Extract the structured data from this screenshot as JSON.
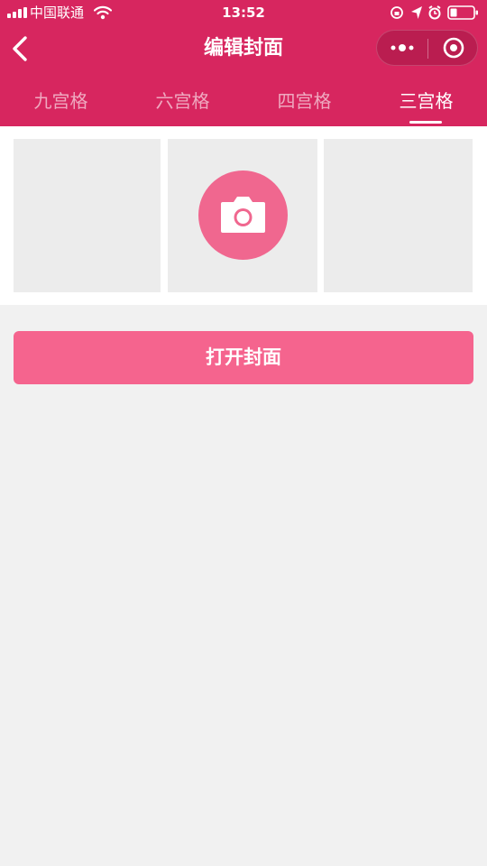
{
  "status_bar": {
    "carrier": "中国联通",
    "time": "13:52"
  },
  "nav": {
    "title": "编辑封面",
    "back_icon": "chevron-left-icon",
    "more_icon": "more-dots-icon",
    "close_icon": "target-circle-icon"
  },
  "tabs": [
    {
      "label": "九宫格",
      "active": false
    },
    {
      "label": "六宫格",
      "active": false
    },
    {
      "label": "四宫格",
      "active": false
    },
    {
      "label": "三宫格",
      "active": true
    }
  ],
  "grid": {
    "upload_icon": "camera-icon"
  },
  "open_button": {
    "label": "打开封面"
  },
  "colors": {
    "header": "#d7265f",
    "accent": "#f5648e",
    "camera_circle": "#f0678f",
    "cell": "#ececec",
    "page_bg": "#f1f1f1"
  }
}
